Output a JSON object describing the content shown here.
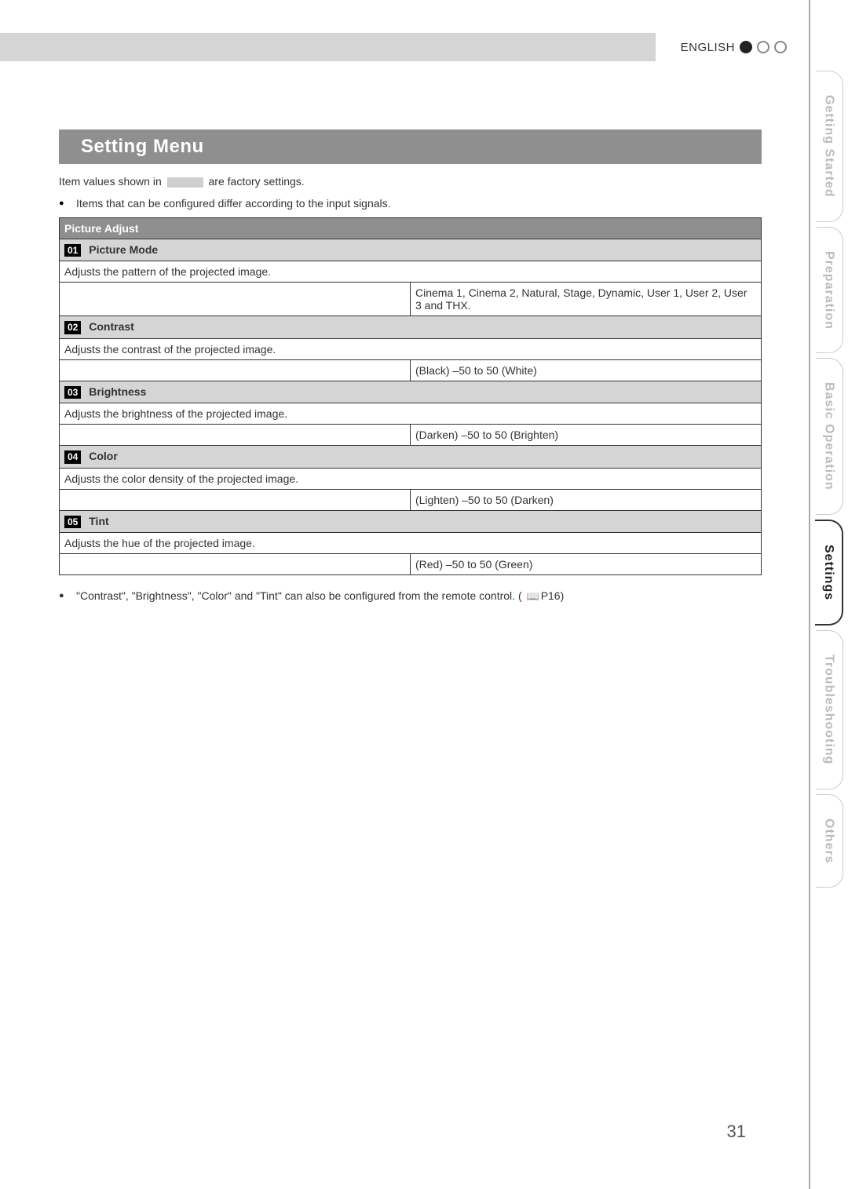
{
  "header": {
    "language_label": "ENGLISH"
  },
  "heading": "Setting Menu",
  "intro_prefix": "Item values shown in ",
  "intro_suffix": " are factory settings.",
  "note1": "Items that can be configured differ according to the input signals.",
  "section_title": "Picture Adjust",
  "rows": [
    {
      "num": "01",
      "title": "Picture Mode",
      "desc": "Adjusts the pattern of the projected image.",
      "value": "Cinema 1, Cinema 2, Natural, Stage, Dynamic, User 1, User 2, User 3 and THX."
    },
    {
      "num": "02",
      "title": "Contrast",
      "desc": "Adjusts the contrast of the projected image.",
      "value": "(Black) –50 to 50 (White)"
    },
    {
      "num": "03",
      "title": "Brightness",
      "desc": "Adjusts the brightness of the projected image.",
      "value": "(Darken) –50 to 50 (Brighten)"
    },
    {
      "num": "04",
      "title": "Color",
      "desc": "Adjusts the color density of the projected image.",
      "value": "(Lighten) –50 to 50 (Darken)"
    },
    {
      "num": "05",
      "title": "Tint",
      "desc": "Adjusts the hue of the projected image.",
      "value": "(Red) –50 to 50 (Green)"
    }
  ],
  "footnote_text": "\"Contrast\", \"Brightness\", \"Color\" and \"Tint\" can also be configured from the remote control. (",
  "footnote_page_ref": "P16",
  "footnote_close": ")",
  "page_number": "31",
  "tabs": {
    "t1": "Getting Started",
    "t2": "Preparation",
    "t3": "Basic Operation",
    "t4": "Settings",
    "t5": "Troubleshooting",
    "t6": "Others"
  }
}
